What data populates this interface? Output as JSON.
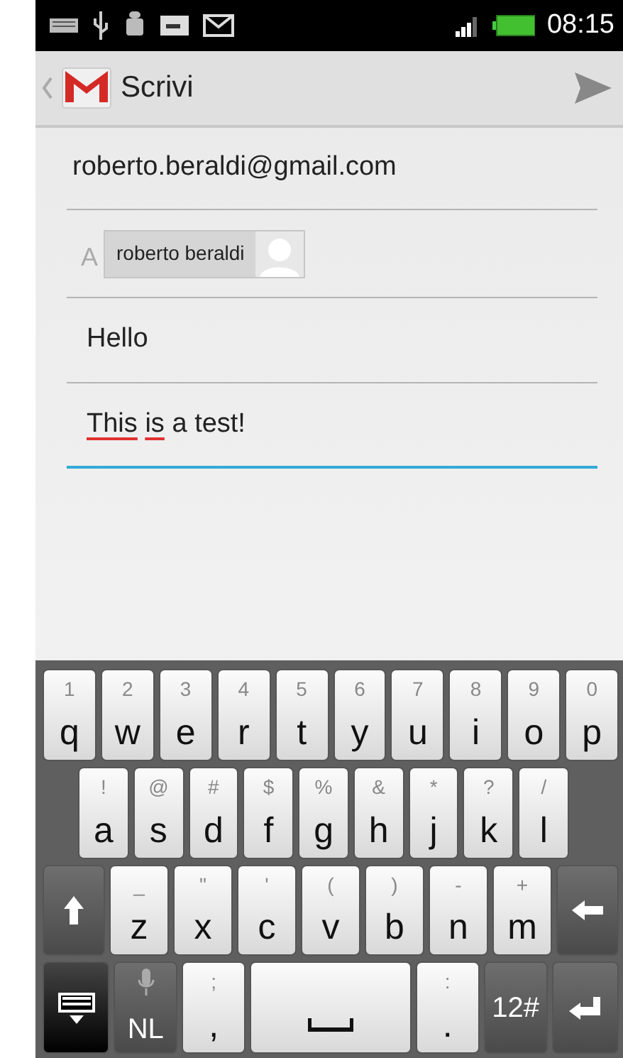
{
  "status_bar": {
    "time": "08:15"
  },
  "action_bar": {
    "title": "Scrivi"
  },
  "compose": {
    "from": "roberto.beraldi@gmail.com",
    "to_label": "A",
    "to_chips": [
      "roberto beraldi"
    ],
    "subject": "Hello",
    "body": [
      {
        "text": "This",
        "misspelled": true
      },
      {
        "text": "is",
        "misspelled": true
      },
      {
        "text": "a",
        "misspelled": false
      },
      {
        "text": "test!",
        "misspelled": false
      }
    ],
    "body_focused": true
  },
  "keyboard": {
    "rows": [
      {
        "keys": [
          {
            "kind": "letter",
            "label": "q",
            "alt": "1"
          },
          {
            "kind": "letter",
            "label": "w",
            "alt": "2"
          },
          {
            "kind": "letter",
            "label": "e",
            "alt": "3"
          },
          {
            "kind": "letter",
            "label": "r",
            "alt": "4"
          },
          {
            "kind": "letter",
            "label": "t",
            "alt": "5"
          },
          {
            "kind": "letter",
            "label": "y",
            "alt": "6"
          },
          {
            "kind": "letter",
            "label": "u",
            "alt": "7"
          },
          {
            "kind": "letter",
            "label": "i",
            "alt": "8"
          },
          {
            "kind": "letter",
            "label": "o",
            "alt": "9"
          },
          {
            "kind": "letter",
            "label": "p",
            "alt": "0"
          }
        ]
      },
      {
        "keys": [
          {
            "kind": "letter",
            "label": "a",
            "alt": "!"
          },
          {
            "kind": "letter",
            "label": "s",
            "alt": "@"
          },
          {
            "kind": "letter",
            "label": "d",
            "alt": "#"
          },
          {
            "kind": "letter",
            "label": "f",
            "alt": "$"
          },
          {
            "kind": "letter",
            "label": "g",
            "alt": "%"
          },
          {
            "kind": "letter",
            "label": "h",
            "alt": "&"
          },
          {
            "kind": "letter",
            "label": "j",
            "alt": "*"
          },
          {
            "kind": "letter",
            "label": "k",
            "alt": "?"
          },
          {
            "kind": "letter",
            "label": "l",
            "alt": "/"
          }
        ]
      },
      {
        "keys": [
          {
            "kind": "shift"
          },
          {
            "kind": "letter",
            "label": "z",
            "alt": "_"
          },
          {
            "kind": "letter",
            "label": "x",
            "alt": "\""
          },
          {
            "kind": "letter",
            "label": "c",
            "alt": "'"
          },
          {
            "kind": "letter",
            "label": "v",
            "alt": "("
          },
          {
            "kind": "letter",
            "label": "b",
            "alt": ")"
          },
          {
            "kind": "letter",
            "label": "n",
            "alt": "-"
          },
          {
            "kind": "letter",
            "label": "m",
            "alt": "+"
          },
          {
            "kind": "backspace"
          }
        ]
      },
      {
        "keys": [
          {
            "kind": "hide"
          },
          {
            "kind": "voice",
            "label": "NL"
          },
          {
            "kind": "letter",
            "label": ",",
            "alt": ";"
          },
          {
            "kind": "space"
          },
          {
            "kind": "letter",
            "label": ".",
            "alt": ":"
          },
          {
            "kind": "symbols",
            "label": "12#"
          },
          {
            "kind": "enter"
          }
        ]
      }
    ]
  }
}
